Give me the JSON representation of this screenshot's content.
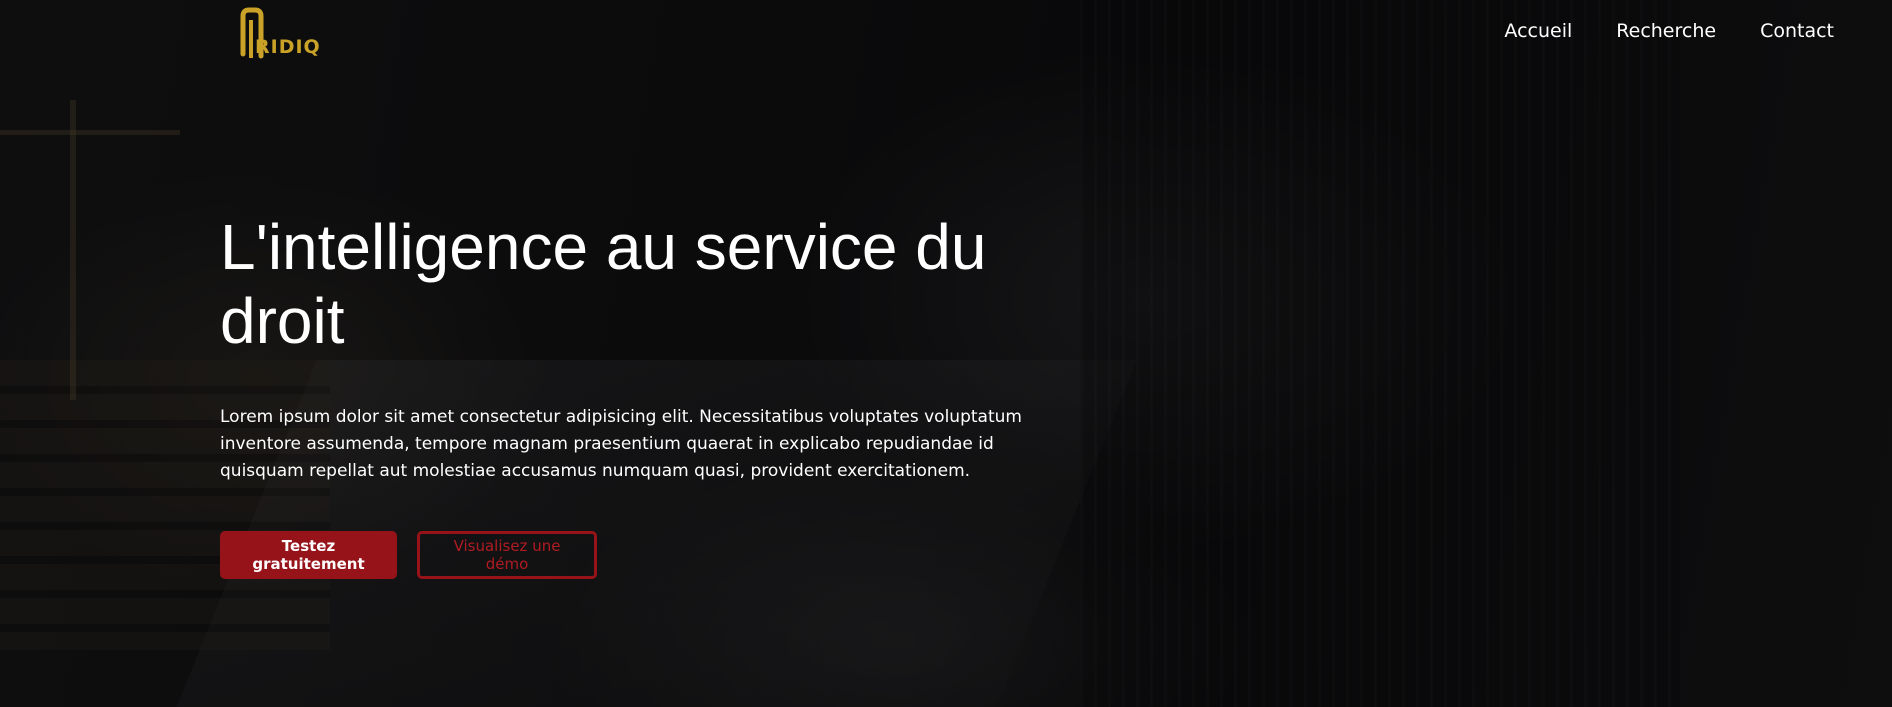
{
  "logo": {
    "text": "RIDIQ",
    "color": "#c9a227"
  },
  "nav": {
    "items": [
      {
        "label": "Accueil"
      },
      {
        "label": "Recherche"
      },
      {
        "label": "Contact"
      }
    ]
  },
  "hero": {
    "headline": "L'intelligence au service du droit",
    "description": "Lorem ipsum dolor sit amet consectetur adipisicing elit. Necessitatibus voluptates voluptatum inventore assumenda, tempore magnam praesentium quaerat in explicabo repudiandae id quisquam repellat aut molestiae accusamus numquam quasi, provident exercitationem.",
    "primary_cta": "Testez gratuitement",
    "secondary_cta": "Visualisez une démo"
  },
  "colors": {
    "accent": "#96131a",
    "gold": "#c9a227",
    "text": "#ffffff"
  }
}
